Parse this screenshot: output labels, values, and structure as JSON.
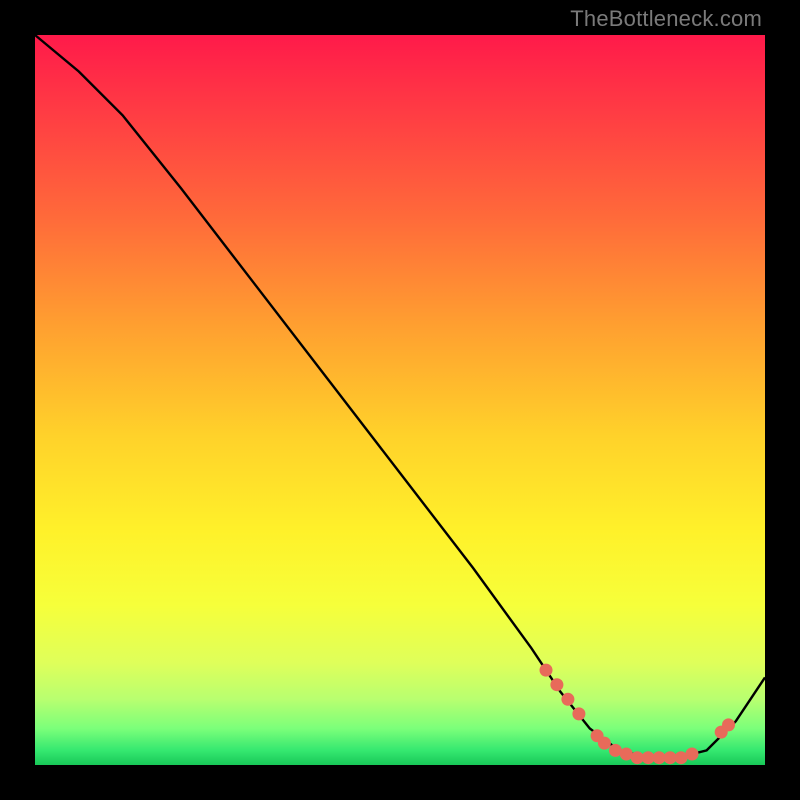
{
  "watermark": "TheBottleneck.com",
  "chart_data": {
    "type": "line",
    "title": "",
    "xlabel": "",
    "ylabel": "",
    "xlim": [
      0,
      100
    ],
    "ylim": [
      0,
      100
    ],
    "grid": false,
    "legend": false,
    "series": [
      {
        "name": "bottleneck-curve",
        "x": [
          0,
          6,
          12,
          20,
          30,
          40,
          50,
          60,
          68,
          72,
          76,
          80,
          84,
          88,
          92,
          96,
          100
        ],
        "y": [
          100,
          95,
          89,
          79,
          66,
          53,
          40,
          27,
          16,
          10,
          5,
          2,
          1,
          1,
          2,
          6,
          12
        ],
        "color": "#000000"
      }
    ],
    "markers": [
      {
        "x": 70,
        "y": 13,
        "color": "#e86a5a"
      },
      {
        "x": 71.5,
        "y": 11,
        "color": "#e86a5a"
      },
      {
        "x": 73,
        "y": 9,
        "color": "#e86a5a"
      },
      {
        "x": 74.5,
        "y": 7,
        "color": "#e86a5a"
      },
      {
        "x": 77,
        "y": 4,
        "color": "#e86a5a"
      },
      {
        "x": 78,
        "y": 3,
        "color": "#e86a5a"
      },
      {
        "x": 79.5,
        "y": 2,
        "color": "#e86a5a"
      },
      {
        "x": 81,
        "y": 1.5,
        "color": "#e86a5a"
      },
      {
        "x": 82.5,
        "y": 1,
        "color": "#e86a5a"
      },
      {
        "x": 84,
        "y": 1,
        "color": "#e86a5a"
      },
      {
        "x": 85.5,
        "y": 1,
        "color": "#e86a5a"
      },
      {
        "x": 87,
        "y": 1,
        "color": "#e86a5a"
      },
      {
        "x": 88.5,
        "y": 1,
        "color": "#e86a5a"
      },
      {
        "x": 90,
        "y": 1.5,
        "color": "#e86a5a"
      },
      {
        "x": 94,
        "y": 4.5,
        "color": "#e86a5a"
      },
      {
        "x": 95,
        "y": 5.5,
        "color": "#e86a5a"
      }
    ]
  },
  "colors": {
    "gradient_top": "#ff1a4a",
    "gradient_mid": "#fff12a",
    "gradient_bottom": "#18c858",
    "curve": "#000000",
    "marker": "#e86a5a",
    "frame": "#000000",
    "watermark": "#7a7a7a"
  }
}
